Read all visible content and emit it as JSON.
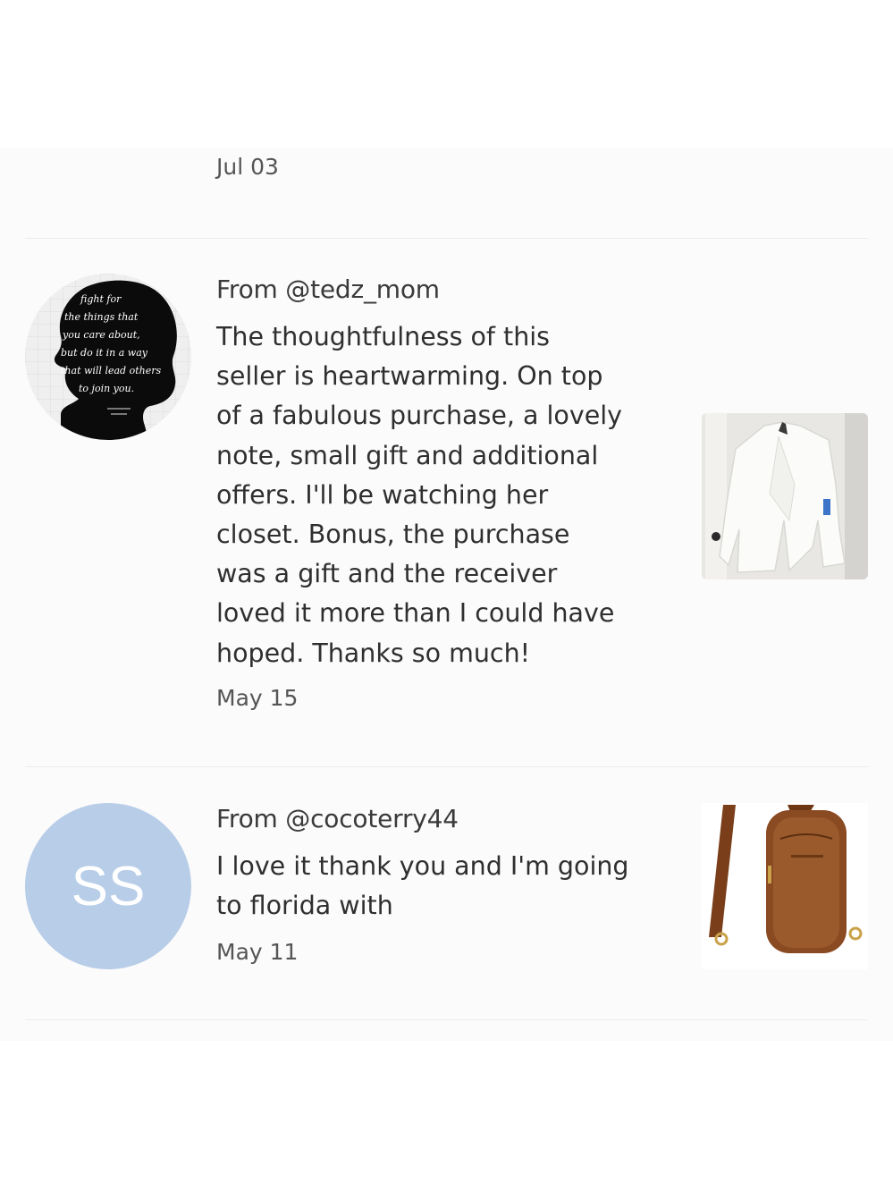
{
  "reviews": [
    {
      "date": "Jul 03"
    },
    {
      "author": "From @tedz_mom",
      "text": "The thoughtfulness of this seller is heartwarming. On top of a fabulous purchase, a lovely note, small gift and additional offers. I'll be watching her closet. Bonus, the purchase was a gift and the receiver loved it more than I could have hoped. Thanks so much!",
      "lines": [
        "The thoughtfulness of this",
        "seller is heartwarming. On top",
        "of a fabulous purchase, a lovely",
        "note, small gift and additional",
        "offers. I'll be watching her",
        "closet. Bonus, the purchase",
        "was a gift and the receiver",
        "loved it more than I could have",
        "hoped. Thanks so much!"
      ],
      "date": "May 15",
      "avatar_icon": "quote-silhouette-avatar",
      "avatar_quote_lines": [
        "fight for",
        "the things that",
        "you care about,",
        "but do it in a way",
        "that will lead others",
        "to join you."
      ],
      "product_icon": "white-jacket-thumbnail"
    },
    {
      "author": "From @cocoterry44",
      "lines": [
        "I love it thank you and I'm going",
        "to florida with"
      ],
      "date": "May 11",
      "avatar_initials": "SS",
      "avatar_color": "#b7cde8",
      "product_icon": "brown-sling-bag-thumbnail"
    }
  ],
  "colors": {
    "panel_background": "#fcfbfb",
    "text": "#2f2f2f",
    "muted_text": "#555555",
    "divider": "#ececec"
  }
}
